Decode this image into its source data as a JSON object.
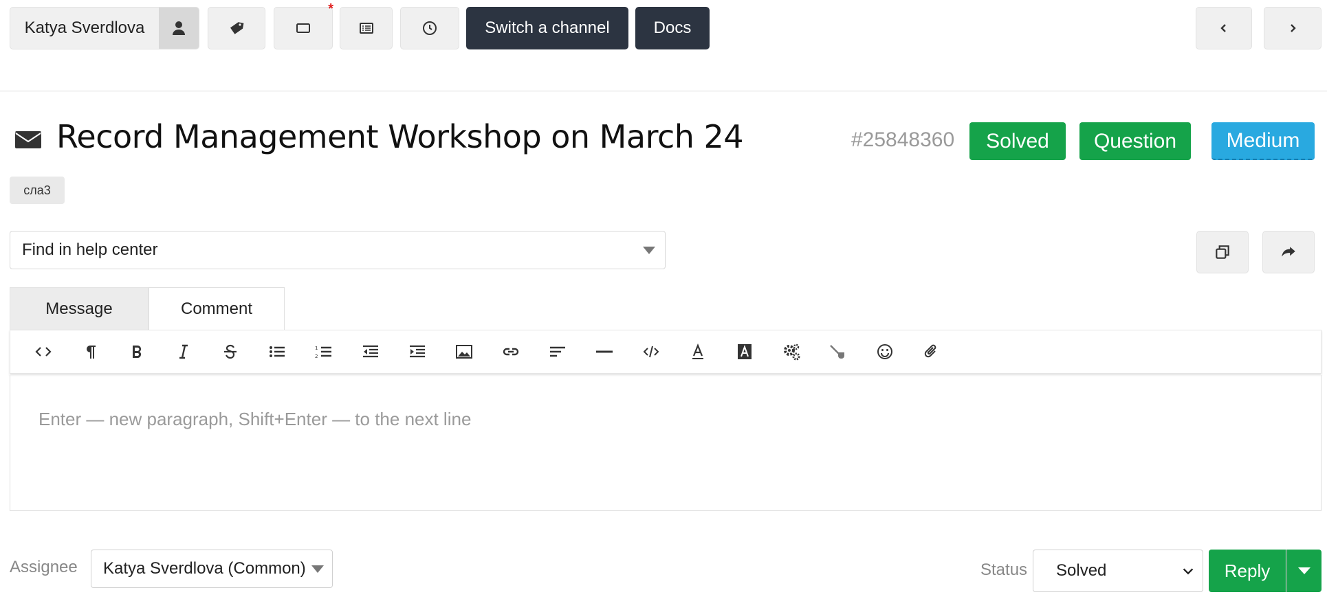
{
  "toolbar": {
    "user_name": "Katya Sverdlova",
    "user_icon": "user-icon",
    "tag_icon": "tag-icon",
    "window_icon": "window-icon",
    "list_icon": "list-icon",
    "clock_icon": "clock-icon",
    "switch_channel_label": "Switch a channel",
    "docs_label": "Docs",
    "prev_icon": "chevron-left-icon",
    "next_icon": "chevron-right-icon",
    "notification_marker": "*"
  },
  "ticket": {
    "title": "Record Management Workshop on March 24",
    "id": "#25848360",
    "status_badge": "Solved",
    "type_badge": "Question",
    "priority_badge": "Medium",
    "tag": "сла3",
    "colors": {
      "success": "#15a34a",
      "info": "#29a9e0",
      "dark": "#2c3441"
    }
  },
  "help_center": {
    "placeholder": "Find in help center"
  },
  "tabs": [
    {
      "label": "Message",
      "active": false
    },
    {
      "label": "Comment",
      "active": true
    }
  ],
  "editor": {
    "placeholder": "Enter — new paragraph, Shift+Enter — to the next line",
    "tools": [
      "source-code",
      "paragraph",
      "bold",
      "italic",
      "strikethrough",
      "bulleted-list",
      "numbered-list",
      "outdent",
      "indent",
      "image",
      "link",
      "align",
      "horizontal-rule",
      "code",
      "font-color",
      "background-color",
      "settings",
      "pipe",
      "emoji",
      "attachment"
    ]
  },
  "footer": {
    "assignee_label": "Assignee",
    "assignee_value": "Katya Sverdlova (Common)",
    "status_label": "Status",
    "status_value": "Solved",
    "reply_label": "Reply"
  }
}
